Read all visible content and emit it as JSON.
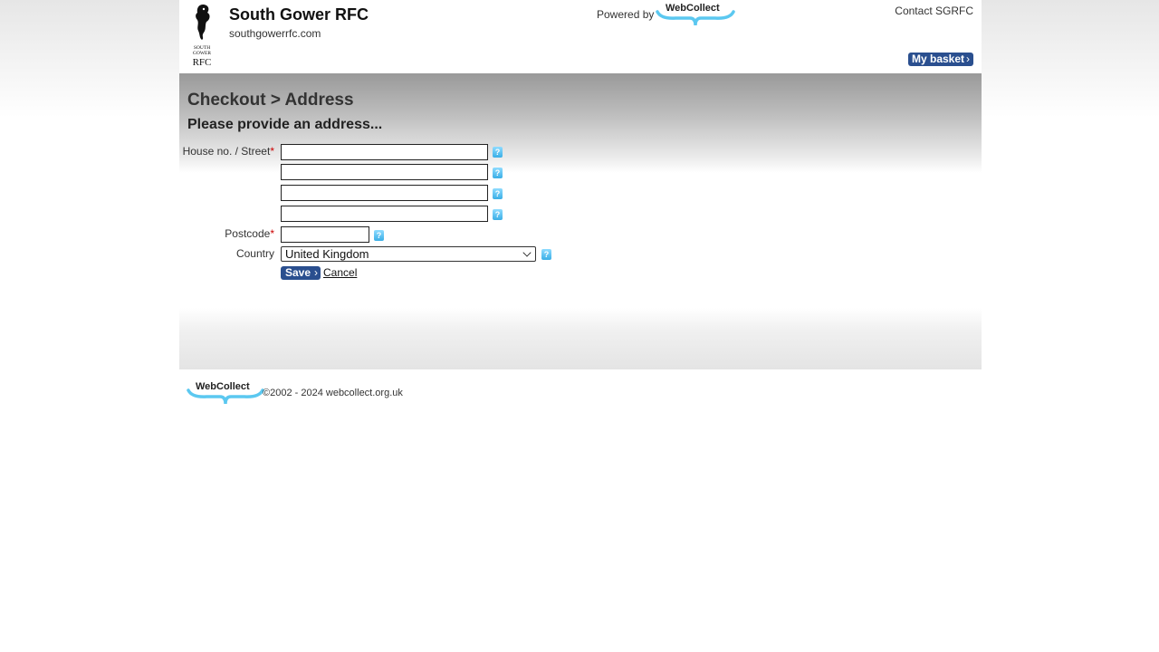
{
  "header": {
    "club_name": "South Gower RFC",
    "club_site": "southgowerrfc.com",
    "powered_by": "Powered by",
    "webcollect_logo": "WebCollect",
    "contact": "Contact SGRFC",
    "basket": "My basket",
    "logo_text_line1": "SOUTH",
    "logo_text_line2": "GOWER",
    "logo_text_line3": "RFC"
  },
  "main": {
    "breadcrumb": "Checkout > Address",
    "subheading": "Please provide an address...",
    "form": {
      "street_label": "House no. / Street",
      "postcode_label": "Postcode",
      "country_label": "Country",
      "required_mark": "*",
      "street_line1": "",
      "street_line2": "",
      "street_line3": "",
      "street_line4": "",
      "postcode": "",
      "country": "United Kingdom",
      "help": "?",
      "save": "Save",
      "cancel": "Cancel"
    }
  },
  "footer": {
    "webcollect_logo": "WebCollect",
    "copyright": "©2002 - 2024 webcollect.org.uk"
  },
  "colors": {
    "button_blue": "#2a4f8f",
    "help_blue": "#3aaee6",
    "required_red": "#cc0000",
    "webcollect_swoosh": "#5bc8f0"
  },
  "icons": {
    "club_logo": "seahorse-icon",
    "help": "help-icon",
    "chevron": "chevron-right-icon",
    "dropdown": "chevron-down-icon"
  }
}
